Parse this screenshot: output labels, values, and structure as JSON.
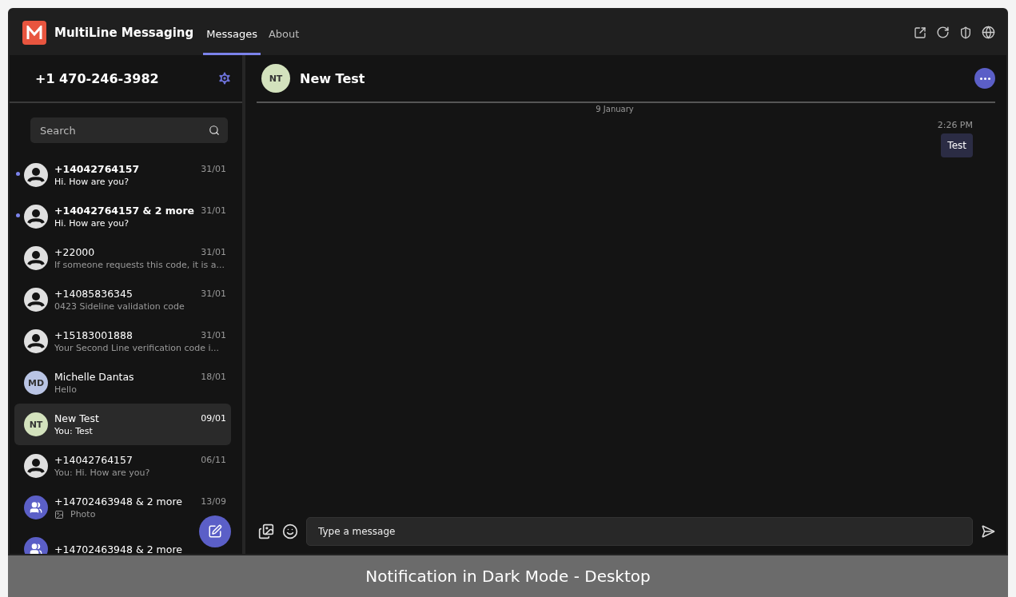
{
  "app": {
    "name": "MultiLine Messaging"
  },
  "tabs": [
    {
      "label": "Messages",
      "selected": true
    },
    {
      "label": "About",
      "selected": false
    }
  ],
  "sidebar": {
    "phone_number": "+1 470-246-3982",
    "search": {
      "placeholder": "Search"
    },
    "conversations": [
      {
        "kind": "person",
        "name": "+14042764157",
        "preview": "Hi. How are you?",
        "date": "31/01",
        "unread": true,
        "selected": false
      },
      {
        "kind": "person",
        "name": "+14042764157 & 2 more",
        "preview": "Hi. How are you?",
        "date": "31/01",
        "unread": true,
        "selected": false
      },
      {
        "kind": "person",
        "name": "+22000",
        "preview": "If someone requests this code, it is a...",
        "date": "31/01",
        "unread": false,
        "selected": false
      },
      {
        "kind": "person",
        "name": "+14085836345",
        "preview": "0423 Sideline validation code",
        "date": "31/01",
        "unread": false,
        "selected": false
      },
      {
        "kind": "person",
        "name": "+15183001888",
        "preview": "Your Second Line verification code i...",
        "date": "31/01",
        "unread": false,
        "selected": false
      },
      {
        "kind": "initials",
        "initials": "MD",
        "color": "#b9c4e4",
        "name": "Michelle Dantas",
        "preview": "Hello",
        "date": "18/01",
        "unread": false,
        "selected": false
      },
      {
        "kind": "initials",
        "initials": "NT",
        "color": "#d3e2bd",
        "name": "New Test",
        "preview": "You: Test",
        "date": "09/01",
        "unread": false,
        "selected": true
      },
      {
        "kind": "person",
        "name": "+14042764157",
        "preview": "You: Hi. How are you?",
        "date": "06/11",
        "unread": false,
        "selected": false
      },
      {
        "kind": "group",
        "name": "+14702463948 & 2 more",
        "preview": "Photo",
        "photo": true,
        "date": "13/09",
        "unread": false,
        "selected": false
      },
      {
        "kind": "group",
        "name": "+14702463948 & 2 more",
        "unread": false,
        "selected": false
      }
    ]
  },
  "chat": {
    "initials": "NT",
    "color": "#d3e2bd",
    "title": "New Test",
    "date_divider": "9 January",
    "messages": [
      {
        "time": "2:26 PM",
        "text": "Test",
        "outgoing": true
      }
    ],
    "composer": {
      "placeholder": "Type a message"
    }
  },
  "caption": "Notification in Dark Mode - Desktop"
}
